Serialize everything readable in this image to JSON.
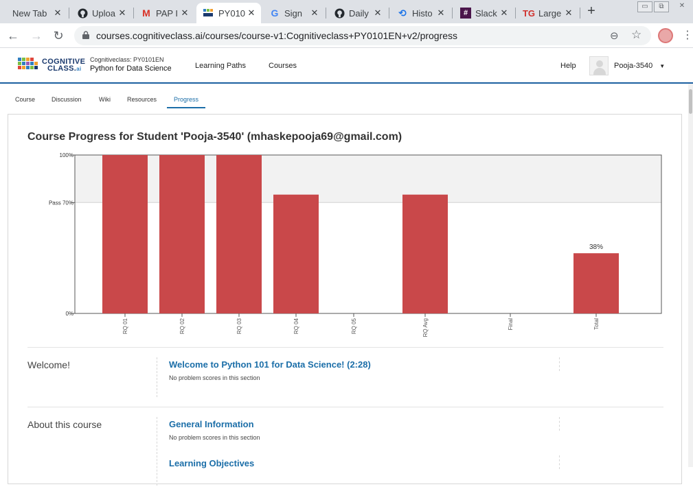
{
  "browser": {
    "tabs": [
      {
        "title": "New Tab",
        "icon": "none"
      },
      {
        "title": "Uploa",
        "icon": "github-icon"
      },
      {
        "title": "PAP I",
        "icon": "gmail-icon"
      },
      {
        "title": "PY010",
        "icon": "cognitiveclass-icon",
        "active": true
      },
      {
        "title": "Sign",
        "icon": "google-icon"
      },
      {
        "title": "Daily",
        "icon": "github-icon"
      },
      {
        "title": "Histo",
        "icon": "history-icon"
      },
      {
        "title": "Slack",
        "icon": "slack-icon"
      },
      {
        "title": "Large",
        "icon": "tg-icon"
      }
    ],
    "url": "courses.cognitiveclass.ai/courses/course-v1:Cognitiveclass+PY0101EN+v2/progress"
  },
  "header": {
    "logo_line1": "COGNITIVE",
    "logo_line2": "CLASS.",
    "logo_suffix": "ai",
    "course_org": "Cognitiveclass: PY0101EN",
    "course_name": "Python for Data Science",
    "nav": [
      "Learning Paths",
      "Courses"
    ],
    "help": "Help",
    "username": "Pooja-3540"
  },
  "course_tabs": [
    "Course",
    "Discussion",
    "Wiki",
    "Resources",
    "Progress"
  ],
  "active_course_tab": "Progress",
  "page_title": "Course Progress for Student 'Pooja-3540' (mhaskepooja69@gmail.com)",
  "chart_data": {
    "type": "bar",
    "categories": [
      "RQ 01",
      "RQ 02",
      "RQ 03",
      "RQ 04",
      "RQ 05",
      "RQ Avg",
      "Final",
      "Total"
    ],
    "values": [
      100,
      100,
      100,
      75,
      0,
      75,
      0,
      38
    ],
    "data_labels": {
      "Total": "38%"
    },
    "ytick_labels": [
      "100%",
      "Pass 70%",
      "0%"
    ],
    "ytick_values": [
      100,
      70,
      0
    ],
    "pass_threshold": 70,
    "ylim": [
      0,
      100
    ],
    "bar_color": "#c9484a",
    "pass_band_color": "#f2f2f2"
  },
  "sections": [
    {
      "name": "Welcome!",
      "subsections": [
        {
          "title": "Welcome to Python 101 for Data Science! (2:28)",
          "note": "No problem scores in this section"
        }
      ]
    },
    {
      "name": "About this course",
      "subsections": [
        {
          "title": "General Information",
          "note": "No problem scores in this section"
        },
        {
          "title": "Learning Objectives",
          "note": ""
        }
      ]
    }
  ]
}
